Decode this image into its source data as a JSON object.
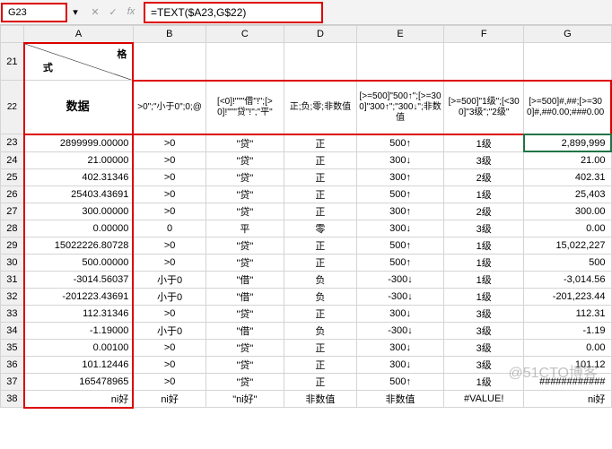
{
  "nameBox": "G23",
  "formula": "=TEXT($A23,G$22)",
  "colHeaders": [
    "A",
    "B",
    "C",
    "D",
    "E",
    "F",
    "G"
  ],
  "diagLabels": {
    "top": "格",
    "bottom": "式"
  },
  "row22": {
    "A": "数据",
    "B": ">0\";\"小于0\";0;@",
    "C": "[<0]!\"\"\"借\"!\";[>0]!\"\"\"贷\"!\";\"平\"",
    "D": "正;负;零;非数值",
    "E": "[>=500]\"500↑\";[>=300]\"300↑\";\"300↓\";非数值",
    "F": "[>=500]\"1级\";[<300]\"3级\";\"2级\"",
    "G": "[>=500]#,##;[>=300]#,##0.00;###0.00"
  },
  "rows": [
    {
      "n": "23",
      "A": "2899999.00000",
      "B": ">0",
      "C": "\"贷\"",
      "D": "正",
      "E": "500↑",
      "F": "1级",
      "G": "2,899,999"
    },
    {
      "n": "24",
      "A": "21.00000",
      "B": ">0",
      "C": "\"贷\"",
      "D": "正",
      "E": "300↓",
      "F": "3级",
      "G": "21.00"
    },
    {
      "n": "25",
      "A": "402.31346",
      "B": ">0",
      "C": "\"贷\"",
      "D": "正",
      "E": "300↑",
      "F": "2级",
      "G": "402.31"
    },
    {
      "n": "26",
      "A": "25403.43691",
      "B": ">0",
      "C": "\"贷\"",
      "D": "正",
      "E": "500↑",
      "F": "1级",
      "G": "25,403"
    },
    {
      "n": "27",
      "A": "300.00000",
      "B": ">0",
      "C": "\"贷\"",
      "D": "正",
      "E": "300↑",
      "F": "2级",
      "G": "300.00"
    },
    {
      "n": "28",
      "A": "0.00000",
      "B": "0",
      "C": "平",
      "D": "零",
      "E": "300↓",
      "F": "3级",
      "G": "0.00"
    },
    {
      "n": "29",
      "A": "15022226.80728",
      "B": ">0",
      "C": "\"贷\"",
      "D": "正",
      "E": "500↑",
      "F": "1级",
      "G": "15,022,227"
    },
    {
      "n": "30",
      "A": "500.00000",
      "B": ">0",
      "C": "\"贷\"",
      "D": "正",
      "E": "500↑",
      "F": "1级",
      "G": "500"
    },
    {
      "n": "31",
      "A": "-3014.56037",
      "B": "小于0",
      "C": "\"借\"",
      "D": "负",
      "E": "-300↓",
      "F": "1级",
      "G": "-3,014.56"
    },
    {
      "n": "32",
      "A": "-201223.43691",
      "B": "小于0",
      "C": "\"借\"",
      "D": "负",
      "E": "-300↓",
      "F": "1级",
      "G": "-201,223.44"
    },
    {
      "n": "33",
      "A": "112.31346",
      "B": ">0",
      "C": "\"贷\"",
      "D": "正",
      "E": "300↓",
      "F": "3级",
      "G": "112.31"
    },
    {
      "n": "34",
      "A": "-1.19000",
      "B": "小于0",
      "C": "\"借\"",
      "D": "负",
      "E": "-300↓",
      "F": "3级",
      "G": "-1.19"
    },
    {
      "n": "35",
      "A": "0.00100",
      "B": ">0",
      "C": "\"贷\"",
      "D": "正",
      "E": "300↓",
      "F": "3级",
      "G": "0.00"
    },
    {
      "n": "36",
      "A": "101.12446",
      "B": ">0",
      "C": "\"贷\"",
      "D": "正",
      "E": "300↓",
      "F": "3级",
      "G": "101.12"
    },
    {
      "n": "37",
      "A": "165478965",
      "B": ">0",
      "C": "\"贷\"",
      "D": "正",
      "E": "500↑",
      "F": "1级",
      "G": "############"
    },
    {
      "n": "38",
      "A": "ni好",
      "B": "ni好",
      "C": "\"ni好\"",
      "D": "非数值",
      "E": "非数值",
      "F": "#VALUE!",
      "G": "ni好"
    }
  ],
  "glyphs": {
    "dropdown": "▾",
    "cancel": "✕",
    "confirm": "✓",
    "fx": "fx"
  },
  "watermark": "@51CTO博客"
}
